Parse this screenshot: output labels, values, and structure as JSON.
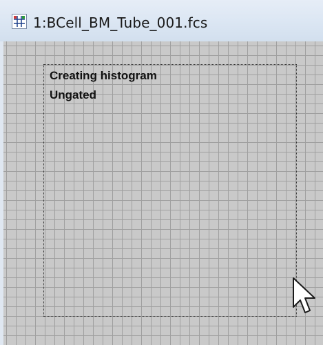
{
  "window": {
    "title": "1:BCell_BM_Tube_001.fcs",
    "app_icon": "plot-window-icon"
  },
  "plot": {
    "status_line_1": "Creating histogram",
    "status_line_2": "Ungated"
  },
  "colors": {
    "titlebar_bg": "#dbe6f3",
    "canvas_bg": "#c9c9c9",
    "grid_line": "#9f9f9f"
  }
}
